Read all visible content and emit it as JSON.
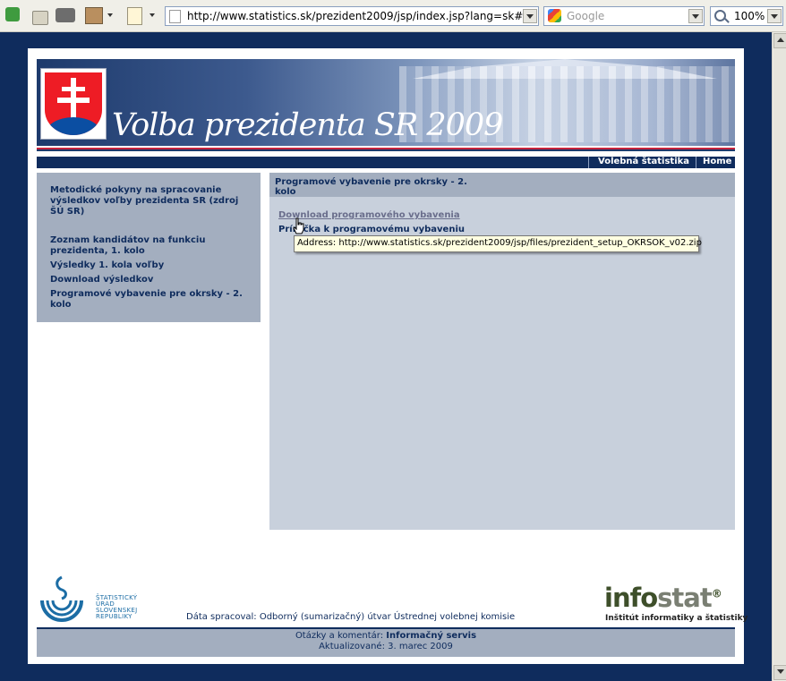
{
  "browser": {
    "address": "http://www.statistics.sk/prezident2009/jsp/index.jsp?lang=sk#",
    "search_placeholder": "Google",
    "zoom": "100%"
  },
  "banner": {
    "title": "Volba prezidenta SR 2009"
  },
  "topnav": {
    "items": [
      "Volebná štatistika",
      "Home"
    ]
  },
  "sidebar": {
    "items": [
      "Metodické pokyny na spracovanie výsledkov voľby prezidenta SR (zdroj ŠÚ SR)",
      "Zoznam kandidátov na funkciu prezidenta, 1. kolo",
      "Výsledky 1. kola voľby",
      "Download výsledkov",
      "Programové vybavenie pre okrsky - 2. kolo"
    ]
  },
  "main": {
    "heading": "Programové vybavenie pre okrsky - 2. kolo",
    "links": [
      "Download programového vybavenia",
      "Príručka k programovému vybaveniu"
    ]
  },
  "tooltip": {
    "text": "Address: http://www.statistics.sk/prezident2009/jsp/files/prezident_setup_OKRSOK_v02.zip"
  },
  "footer": {
    "susr_logo_text": "ŠTATISTICKÝ ÚRAD SLOVENSKEJ REPUBLIKY",
    "processed_label": "Dáta spracoval: Odborný (sumarizačný) útvar Ústrednej volebnej komisie",
    "questions_prefix": "Otázky a komentár: ",
    "questions_link": "Informačný servis",
    "updated": "Aktualizované: 3. marec 2009",
    "infostat_logo_a": "info",
    "infostat_logo_b": "stat",
    "infostat_reg": "®",
    "infostat_sub": "Inštitút informatiky a štatistiky"
  }
}
